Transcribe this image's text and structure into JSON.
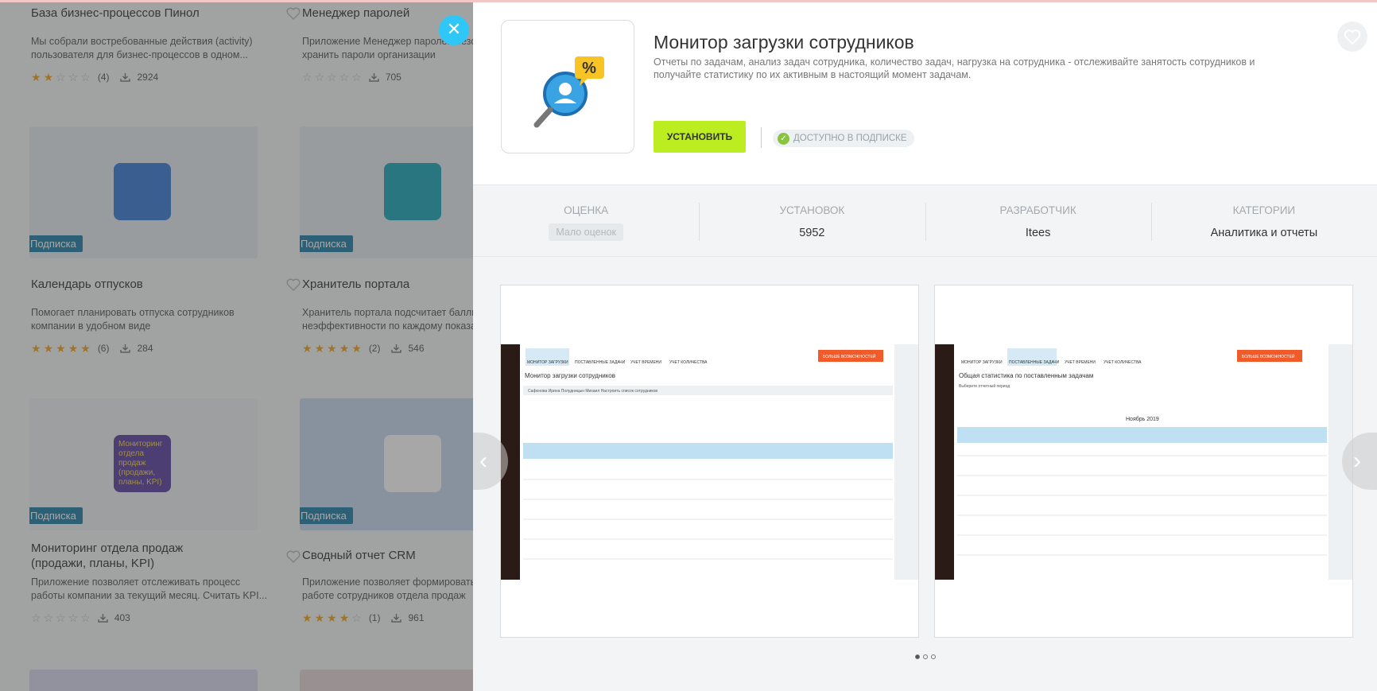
{
  "background": {
    "cards": [
      {
        "title": "База бизнес-процессов Пинол",
        "desc": "Мы собрали востребованные действия (activity) пользователя для бизнес-процессов в одном...",
        "rating": 2,
        "reviews": "(4)",
        "installs": "2924"
      },
      {
        "title": "Менеджер паролей",
        "desc": "Приложение Менеджер паролей безопасно хранить пароли организации",
        "rating": 0,
        "reviews": "",
        "installs": "705"
      },
      {
        "title": "Календарь отпусков",
        "desc": "Помогает планировать отпуска сотрудников компании в удобном виде",
        "rating": 5,
        "reviews": "(6)",
        "installs": "284",
        "badge": "Подписка"
      },
      {
        "title": "Хранитель портала",
        "desc": "Хранитель портала подсчитает баллы неэффективности по каждому показателю",
        "rating": 5,
        "reviews": "(2)",
        "installs": "546",
        "badge": "Подписка"
      },
      {
        "title": "Мониторинг отдела продаж (продажи, планы, KPI)",
        "desc": "Приложение позволяет отслеживать процесс работы компании за текущий месяц. Считать KPI...",
        "rating": 0,
        "reviews": "",
        "installs": "403",
        "badge": "Подписка",
        "logo_text": "Мониторинг отдела продаж (продажи, планы, KPI)"
      },
      {
        "title": "Сводный отчет CRM",
        "desc": "Приложение позволяет формировать отчет по работе сотрудников отдела продаж",
        "rating": 4,
        "reviews": "(1)",
        "installs": "961",
        "badge": "Подписка"
      }
    ]
  },
  "panel": {
    "close_icon": "✕",
    "app_title": "Монитор загрузки сотрудников",
    "app_desc": "Отчеты по задачам, анализ задач сотрудника, количество задач, нагрузка на сотрудника - отслеживайте занятость сотрудников и получайте статистику по их активным в настоящий момент задачам.",
    "install_label": "УСТАНОВИТЬ",
    "available_label": "ДОСТУПНО В ПОДПИСКЕ",
    "info": [
      {
        "label": "ОЦЕНКА",
        "value": "Мало оценок"
      },
      {
        "label": "УСТАНОВОК",
        "value": "5952"
      },
      {
        "label": "РАЗРАБОТЧИК",
        "value": "Itees"
      },
      {
        "label": "КАТЕГОРИИ",
        "value": "Аналитика и отчеты"
      }
    ],
    "screenshots": [
      {
        "tabs": [
          "МОНИТОР ЗАГРУЗКИ",
          "ПОСТАВЛЕННЫЕ ЗАДАЧИ",
          "УЧЕТ ВРЕМЕНИ",
          "УЧЕТ КОЛИЧЕСТВА"
        ],
        "button": "БОЛЬШЕ ВОЗМОЖНОСТЕЙ",
        "heading": "Монитор загрузки сотрудников",
        "sub": "Сафонова Ирина   Полудницын Михаил   Настроить список сотрудников"
      },
      {
        "tabs": [
          "МОНИТОР ЗАГРУЗКИ",
          "ПОСТАВЛЕННЫЕ ЗАДАЧИ",
          "УЧЕТ ВРЕМЕНИ",
          "УЧЕТ КОЛИЧЕСТВА"
        ],
        "button": "БОЛЬШЕ ВОЗМОЖНОСТЕЙ",
        "heading": "Общая статистика по поставленным задачам",
        "sub": "Выберите отчетный период",
        "month": "Ноябрь 2019"
      }
    ]
  },
  "colors": {
    "accent": "#bbed21",
    "close": "#2fc7f7",
    "badge": "#1e7fa8",
    "star": "#f2a218"
  }
}
